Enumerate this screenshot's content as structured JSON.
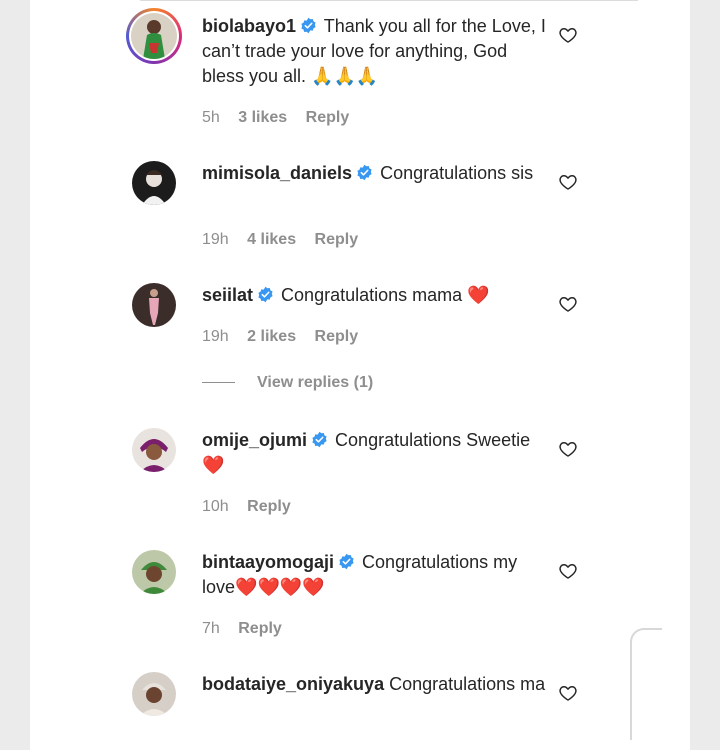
{
  "comments": [
    {
      "username": "biolabayo1",
      "text": "Thank you all for the Love, I can’t trade your love for anything, God bless you all.",
      "emoji": "🙏🙏🙏",
      "time": "5h",
      "likes": "3 likes",
      "reply": "Reply"
    },
    {
      "username": "mimisola_daniels",
      "text": "Congratulations sis",
      "emoji": "",
      "time": "19h",
      "likes": "4 likes",
      "reply": "Reply"
    },
    {
      "username": "seiilat",
      "text": "Congratulations mama",
      "emoji": "❤️",
      "time": "19h",
      "likes": "2 likes",
      "reply": "Reply"
    },
    {
      "username": "omije_ojumi",
      "text": "Congratulations Sweetie",
      "emoji": "❤️",
      "time": "10h",
      "likes": "",
      "reply": "Reply"
    },
    {
      "username": "bintaayomogaji",
      "text": "Congratulations my love",
      "emoji": "❤️❤️❤️❤️",
      "time": "7h",
      "likes": "",
      "reply": "Reply"
    },
    {
      "username": "bodataiye_oniyakuya",
      "text": "Congratulations ma",
      "emoji": "",
      "time": "",
      "likes": "",
      "reply": ""
    }
  ],
  "view_replies": "View replies (1)",
  "icons": {
    "verified": "verified-badge-icon",
    "like": "heart-outline-icon"
  },
  "colors": {
    "verified": "#3897f0",
    "text": "#262626",
    "meta": "#8e8e8e",
    "heart_emoji": "#dd1f2f"
  }
}
